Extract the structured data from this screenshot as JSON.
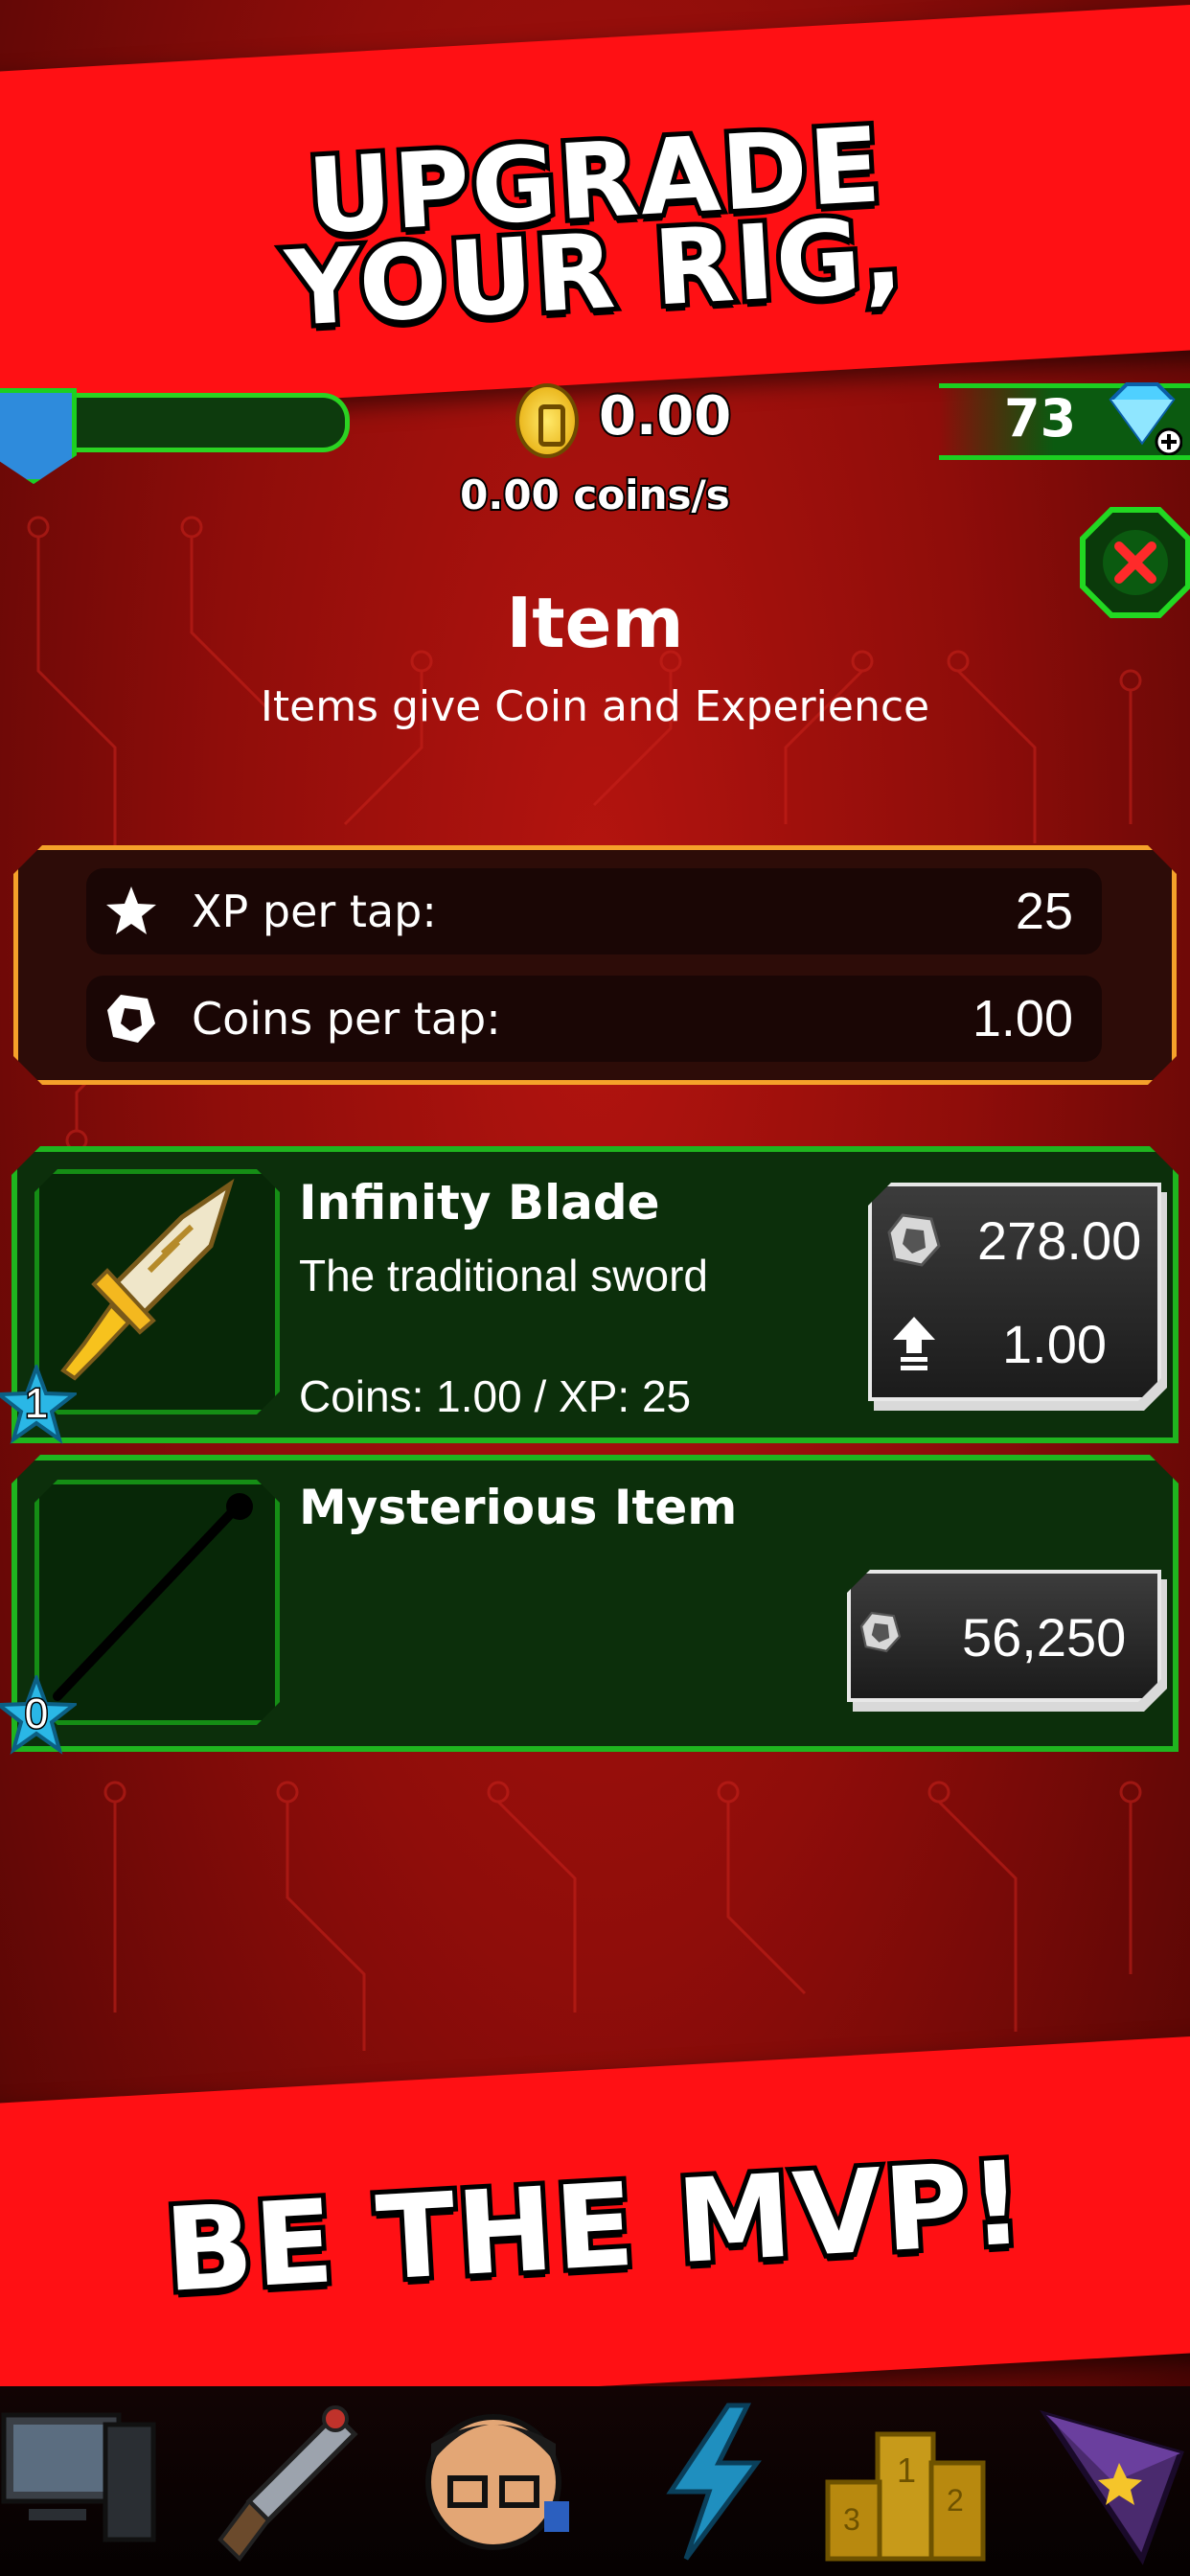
{
  "promo": {
    "top_line1": "UPGRADE",
    "top_line2": "YOUR RIG,",
    "bottom": "BE THE MVP!"
  },
  "header": {
    "coins": "0.00",
    "coins_rate": "0.00 coins/s",
    "gems": "73",
    "level_icon": "level-badge-icon",
    "coin_icon": "gold-coin-icon",
    "gem_icon": "diamond-plus-icon",
    "close_icon": "close-icon"
  },
  "page": {
    "title": "Item",
    "subtitle": "Items give Coin and Experience"
  },
  "stats": {
    "xp_label": "XP per tap:",
    "xp_value": "25",
    "coins_label": "Coins per tap:",
    "coins_value": "1.00"
  },
  "items": [
    {
      "name": "Infinity Blade",
      "description": "The traditional sword",
      "stats": "Coins: 1.00 / XP: 25",
      "level": "1",
      "price": "278.00",
      "upgrade_gain": "1.00",
      "icon": "sword-icon"
    },
    {
      "name": "Mysterious Item",
      "level": "0",
      "price": "56,250",
      "icon": "staff-icon"
    }
  ],
  "bottom_nav": [
    {
      "icon": "computer-icon"
    },
    {
      "icon": "dagger-icon"
    },
    {
      "icon": "gamer-avatar-icon"
    },
    {
      "icon": "lightning-icon"
    },
    {
      "icon": "podium-icon"
    },
    {
      "icon": "crystal-icon"
    }
  ],
  "colors": {
    "banner": "#ff1014",
    "background": "#9a0f0b",
    "card_border": "#1fb51f",
    "stats_border": "#f5a12a"
  }
}
